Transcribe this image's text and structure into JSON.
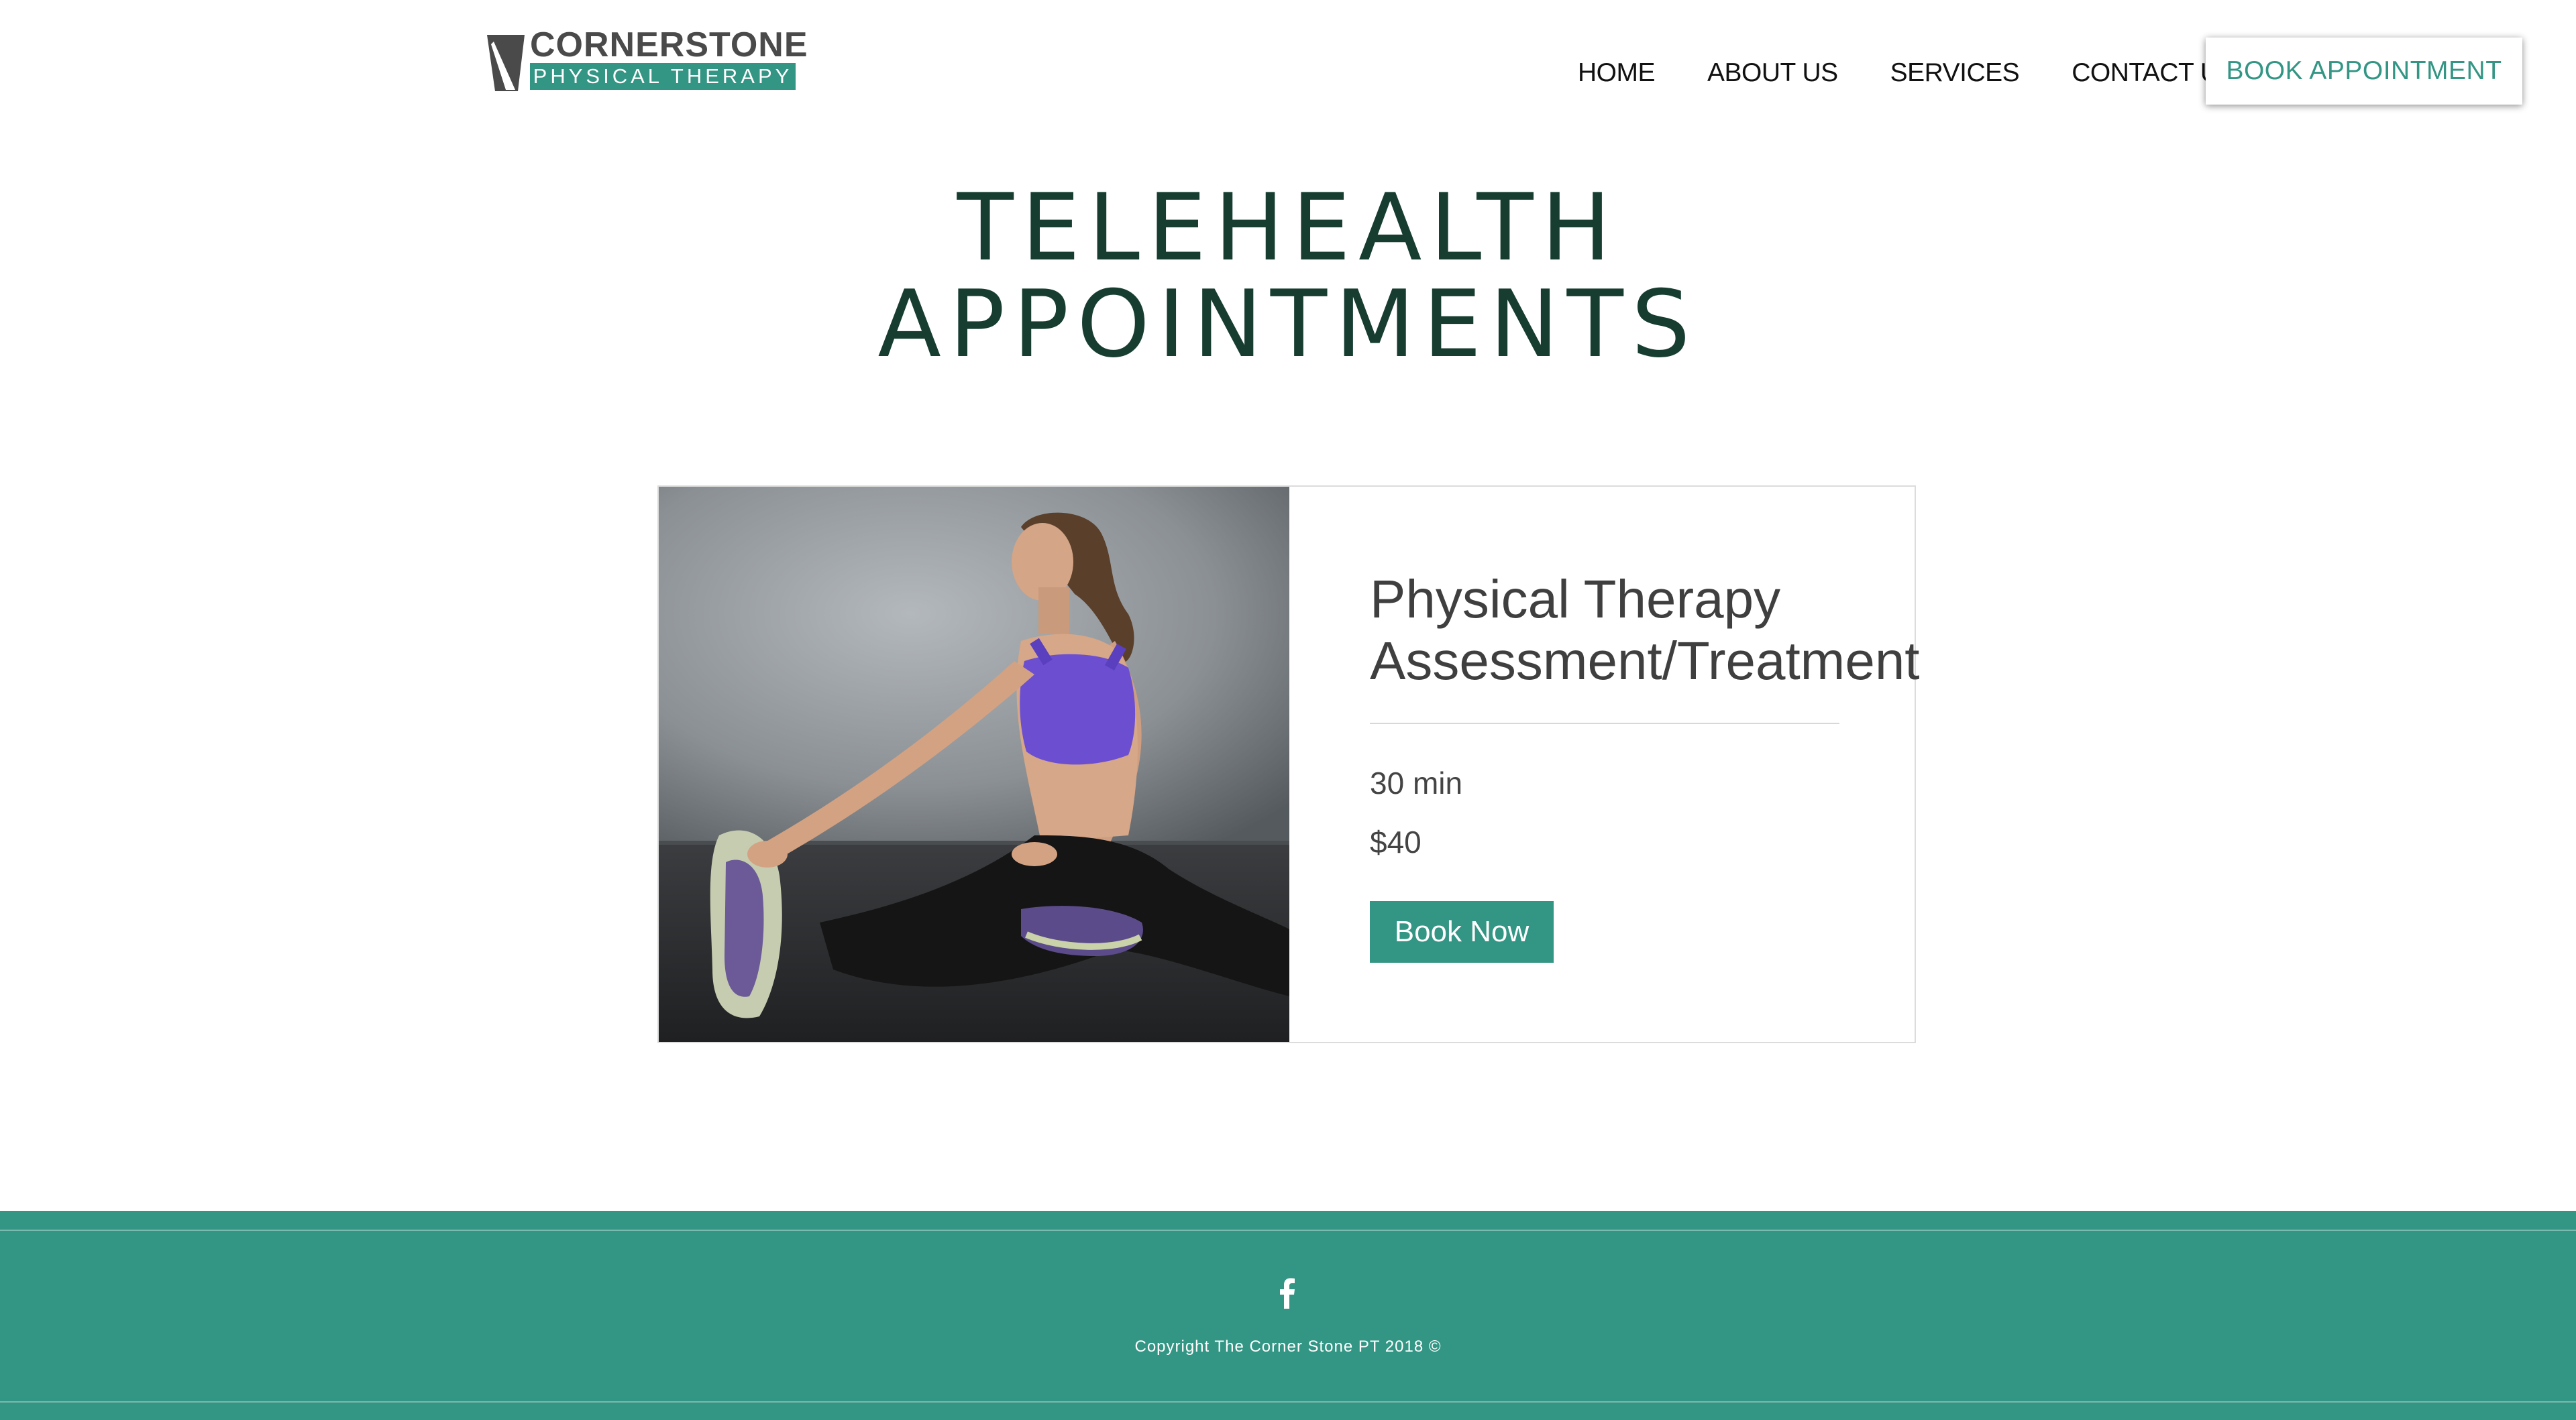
{
  "brand": {
    "name": "CORNERSTONE",
    "tagline": "PHYSICAL THERAPY",
    "colors": {
      "accent": "#339584",
      "title": "#173d31",
      "text": "#3f3f3f"
    }
  },
  "nav": {
    "items": [
      {
        "label": "HOME"
      },
      {
        "label": "ABOUT US"
      },
      {
        "label": "SERVICES"
      },
      {
        "label": "CONTACT US"
      }
    ],
    "cta_label": "BOOK APPOINTMENT"
  },
  "page": {
    "title_line1": "TELEHEALTH",
    "title_line2": "APPOINTMENTS"
  },
  "service": {
    "title_line1": "Physical Therapy",
    "title_line2": "Assessment/Treatment",
    "duration": "30 min",
    "price": "$40",
    "button_label": "Book Now",
    "image": "woman-stretching-photo"
  },
  "footer": {
    "social_icon": "facebook-icon",
    "copyright": "Copyright The Corner Stone PT 2018 ©"
  }
}
